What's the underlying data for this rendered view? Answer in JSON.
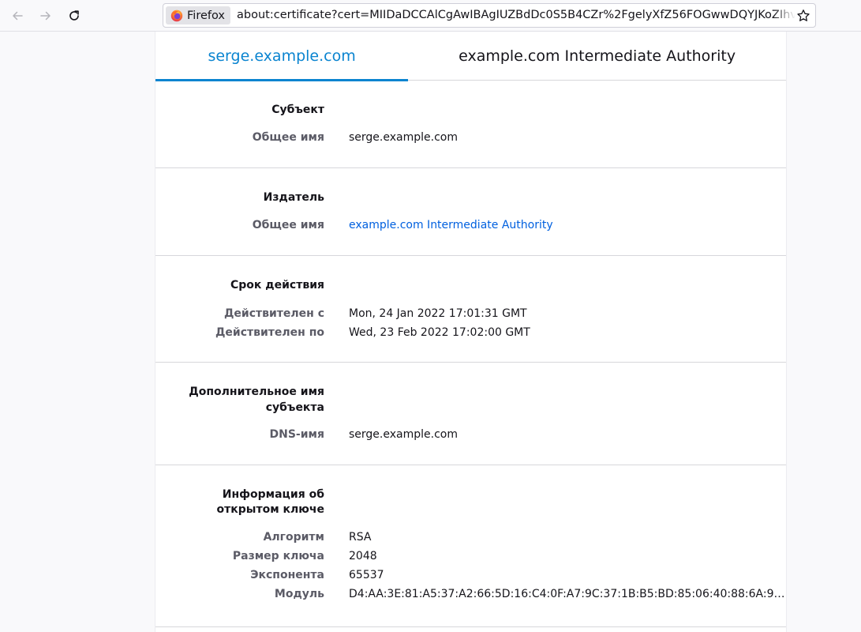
{
  "browser": {
    "identity_label": "Firefox",
    "url": "about:certificate?cert=MIIDaDCCAlCgAwIBAgIUZBdDc0S5B4CZr%2FgelyXfZ56FOGwwDQYJKoZIhvcNAQELBQAw",
    "icons": {
      "back": "back-arrow-icon",
      "forward": "forward-arrow-icon",
      "reload": "reload-icon",
      "bookmark": "star-icon",
      "identity": "firefox-logo-icon"
    }
  },
  "tabs": [
    {
      "label": "serge.example.com",
      "active": true
    },
    {
      "label": "example.com Intermediate Authority",
      "active": false
    }
  ],
  "sections": {
    "subject": {
      "title": "Субъект",
      "rows": [
        {
          "label": "Общее имя",
          "value": "serge.example.com"
        }
      ]
    },
    "issuer": {
      "title": "Издатель",
      "rows": [
        {
          "label": "Общее имя",
          "value": "example.com Intermediate Authority"
        }
      ]
    },
    "validity": {
      "title": "Срок действия",
      "rows": [
        {
          "label": "Действителен с",
          "value": "Mon, 24 Jan 2022 17:01:31 GMT"
        },
        {
          "label": "Действителен по",
          "value": "Wed, 23 Feb 2022 17:02:00 GMT"
        }
      ]
    },
    "san": {
      "title_line1": "Дополнительное имя",
      "title_line2": "субъекта",
      "rows": [
        {
          "label": "DNS-имя",
          "value": "serge.example.com"
        }
      ]
    },
    "public_key": {
      "title_line1": "Информация об",
      "title_line2": "открытом ключе",
      "rows": [
        {
          "label": "Алгоритм",
          "value": "RSA"
        },
        {
          "label": "Размер ключа",
          "value": "2048"
        },
        {
          "label": "Экспонента",
          "value": "65537"
        },
        {
          "label": "Модуль",
          "value": "D4:AA:3E:81:A5:37:A2:66:5D:16:C4:0F:A7:9C:37:1B:B5:BD:85:06:40:88:6A:9…"
        }
      ]
    }
  },
  "colors": {
    "accent": "#0a84d0",
    "link": "#0060df",
    "label": "#5b5b66",
    "divider": "#d7d7db"
  }
}
